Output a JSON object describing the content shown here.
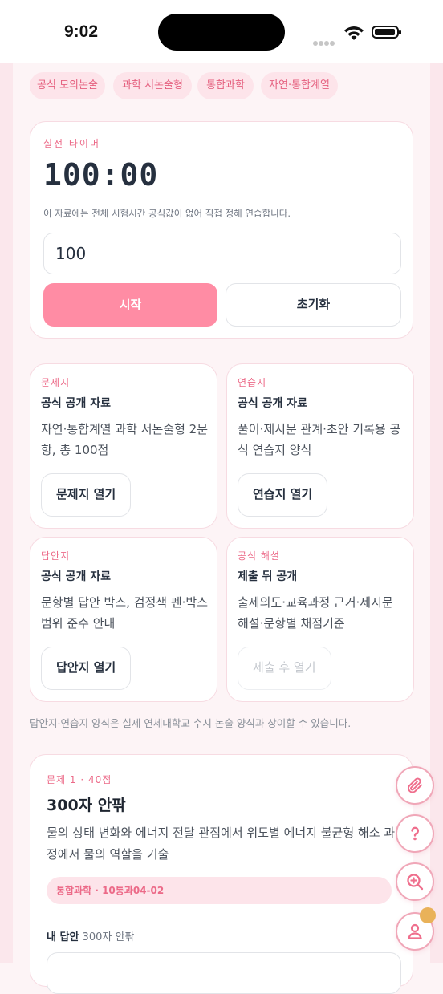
{
  "status_bar": {
    "time": "9:02"
  },
  "chips": [
    "공식 모의논술",
    "과학 서논술형",
    "통합과학",
    "자연·통합계열"
  ],
  "timer": {
    "eyebrow": "실전 타이머",
    "value": "100:00",
    "note": "이 자료에는 전체 시험시간 공식값이 없어 직접 정해 연습합니다.",
    "input_value": "100",
    "start_label": "시작",
    "reset_label": "초기화"
  },
  "materials": [
    {
      "eyebrow": "문제지",
      "title": "공식 공개 자료",
      "desc": "자연·통합계열 과학 서논술형 2문항, 총 100점",
      "button": "문제지 열기",
      "enabled": true
    },
    {
      "eyebrow": "연습지",
      "title": "공식 공개 자료",
      "desc": "풀이·제시문 관계·초안 기록용 공식 연습지 양식",
      "button": "연습지 열기",
      "enabled": true
    },
    {
      "eyebrow": "답안지",
      "title": "공식 공개 자료",
      "desc": "문항별 답안 박스, 검정색 펜·박스 범위 준수 안내",
      "button": "답안지 열기",
      "enabled": true
    },
    {
      "eyebrow": "공식 해설",
      "title": "제출 뒤 공개",
      "desc": "출제의도·교육과정 근거·제시문 해설·문항별 채점기준",
      "button": "제출 후 열기",
      "enabled": false
    }
  ],
  "disclaimer": "답안지·연습지 양식은 실제 연세대학교 수시 논술 양식과 상이할 수 있습니다.",
  "question": {
    "eyebrow": "문제 1 · 40점",
    "title": "300자 안팎",
    "desc": "물의 상태 변화와 에너지 전달 관점에서 위도별 에너지 불균형 해소 과정에서 물의 역할을 기술",
    "tag": "통합과학 · 10통과04-02",
    "answer_label": "내 답안",
    "answer_sub": "300자 안팎"
  },
  "fabs": [
    "paperclip-icon",
    "question-icon",
    "zoom-in-icon",
    "user-icon"
  ],
  "colors": {
    "accent": "#ff8ca4",
    "accent_text": "#ec6a88",
    "chip_bg": "#fde4ea",
    "badge": "#e9b259"
  }
}
